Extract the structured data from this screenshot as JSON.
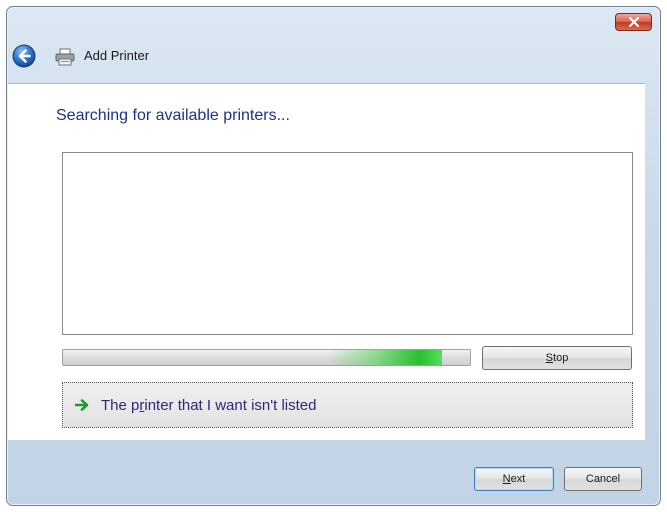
{
  "window": {
    "title": "Add Printer"
  },
  "content": {
    "heading": "Searching for available printers...",
    "progress": 0.93,
    "stop_label_pre": "",
    "stop_label_key": "S",
    "stop_label_post": "top",
    "link_label_pre": "The p",
    "link_label_key": "r",
    "link_label_post": "inter that I want isn't listed"
  },
  "footer": {
    "next_label_pre": "",
    "next_label_key": "N",
    "next_label_post": "ext",
    "cancel_label": "Cancel"
  },
  "colors": {
    "heading": "#1e3287",
    "progress_glow": "#22c02a",
    "close_button": "#c23b22"
  },
  "icons": {
    "back": "back-arrow-icon",
    "printer": "printer-icon",
    "close": "close-icon",
    "link": "green-arrow-icon"
  }
}
